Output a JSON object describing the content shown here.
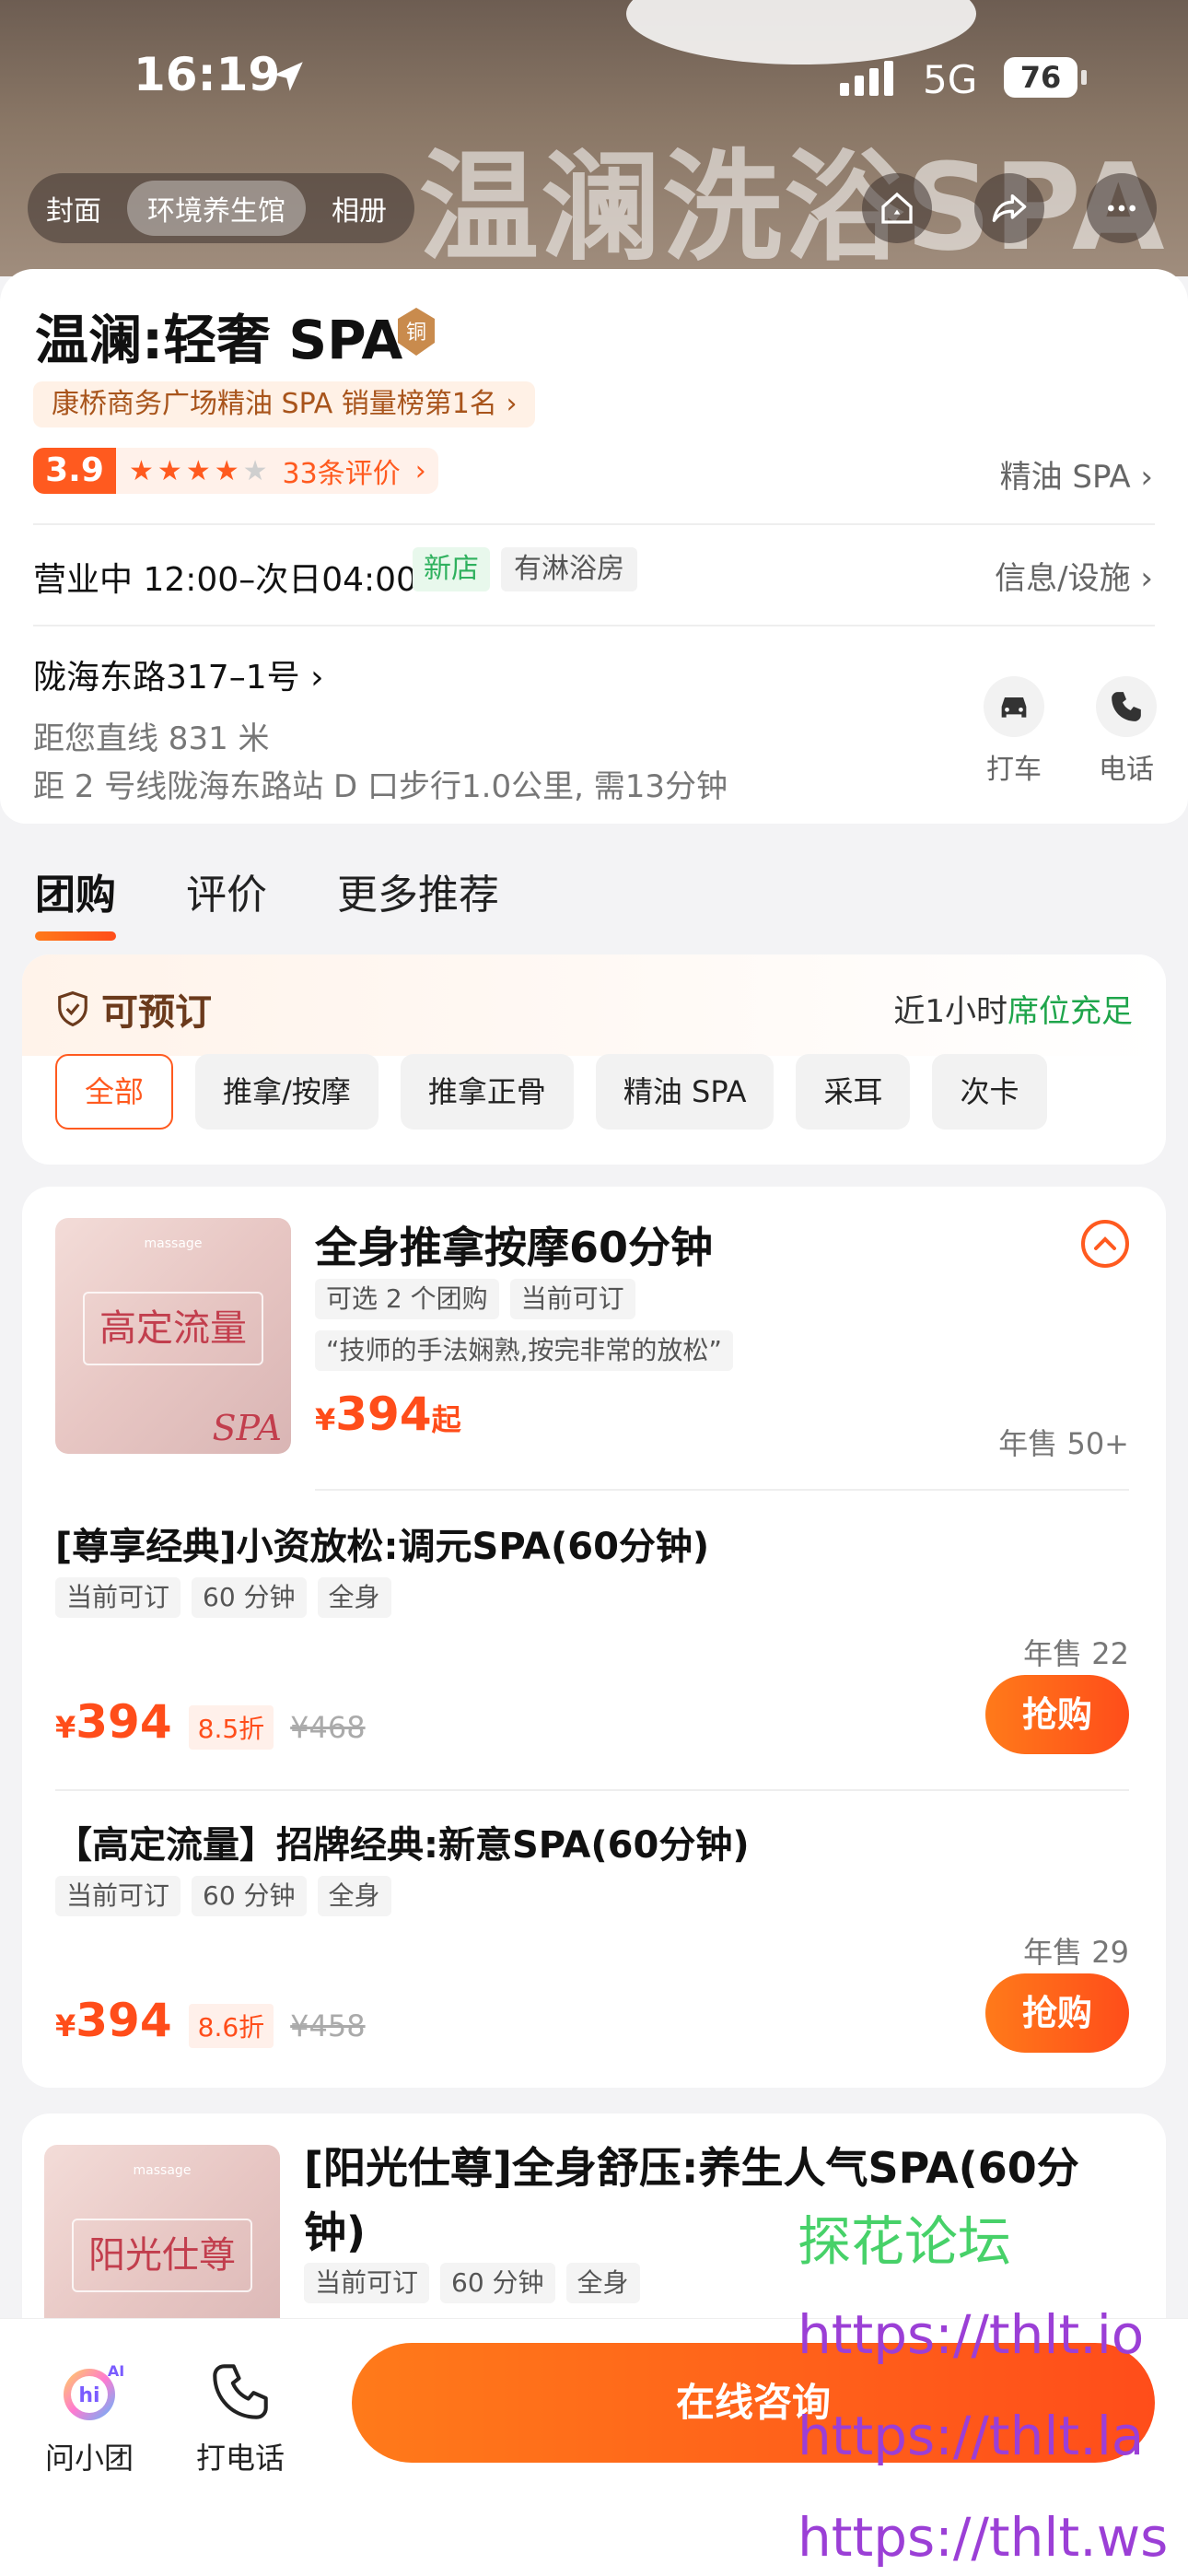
{
  "status_bar": {
    "time": "16:19",
    "network": "5G",
    "battery": "76"
  },
  "hero": {
    "banner_text": "温澜洗浴SPA",
    "tabs": [
      "封面",
      "环境养生馆",
      "相册"
    ]
  },
  "shop": {
    "name": "温澜:轻奢 SPA",
    "medal": "铜",
    "rank_text": "康桥商务广场精油 SPA 销量榜第1名",
    "score": "3.9",
    "stars_filled": 4,
    "review_count": "33条评价",
    "category": "精油 SPA",
    "hours": "营业中 12:00–次日04:00",
    "tag_new": "新店",
    "tag_facility": "有淋浴房",
    "info_link": "信息/设施",
    "address": "陇海东路317–1号",
    "distance": "距您直线 831 米",
    "transit": "距 2 号线陇海东路站 D 口步行1.0公里, 需13分钟",
    "actions": {
      "taxi": "打车",
      "phone": "电话"
    }
  },
  "section_tabs": [
    "团购",
    "评价",
    "更多推荐"
  ],
  "filter": {
    "bookable": "可预订",
    "seat_prefix": "近1小时",
    "seat_status": "席位充足",
    "chips": [
      "全部",
      "推拿/按摩",
      "推拿正骨",
      "精油 SPA",
      "采耳",
      "次卡"
    ]
  },
  "deal": {
    "thumb_text": "高定流量",
    "thumb_small": "massage",
    "thumb_spa": "SPA",
    "title": "全身推拿按摩60分钟",
    "tags": [
      "可选 2 个团购",
      "当前可订"
    ],
    "quote": "“技师的手法娴熟,按完非常的放松”",
    "price_symbol": "¥",
    "price": "394",
    "price_suffix": "起",
    "sold": "年售 50+",
    "items": [
      {
        "title": "[尊享经典]小资放松:调元SPA(60分钟)",
        "tags": [
          "当前可订",
          "60 分钟",
          "全身"
        ],
        "sold": "年售 22",
        "price": "394",
        "discount": "8.5折",
        "original": "¥468",
        "buy": "抢购"
      },
      {
        "title": "【高定流量】招牌经典:新意SPA(60分钟)",
        "tags": [
          "当前可订",
          "60 分钟",
          "全身"
        ],
        "sold": "年售 29",
        "price": "394",
        "discount": "8.6折",
        "original": "¥458",
        "buy": "抢购"
      }
    ]
  },
  "deal2": {
    "thumb_text": "阳光仕尊",
    "thumb_small": "massage",
    "title": "[阳光仕尊]全身舒压:养生人气SPA(60分钟)",
    "tags": [
      "当前可订",
      "60 分钟",
      "全身"
    ]
  },
  "bottom_bar": {
    "assistant": "问小团",
    "assistant_badge": "AI",
    "call": "打电话",
    "consult": "在线咨询"
  },
  "watermark": {
    "name": "探花论坛",
    "urls": [
      "https://thlt.io",
      "https://thlt.la",
      "https://thlt.ws"
    ]
  },
  "colors": {
    "accent": "#ff5a1f",
    "green": "#1fa54b",
    "brown": "#6b3a1c"
  },
  "icons": [
    "location-arrow-icon",
    "home-icon",
    "share-icon",
    "more-icon",
    "taxi-icon",
    "phone-icon",
    "shield-check-icon",
    "chevron-up-icon",
    "assistant-icon"
  ]
}
